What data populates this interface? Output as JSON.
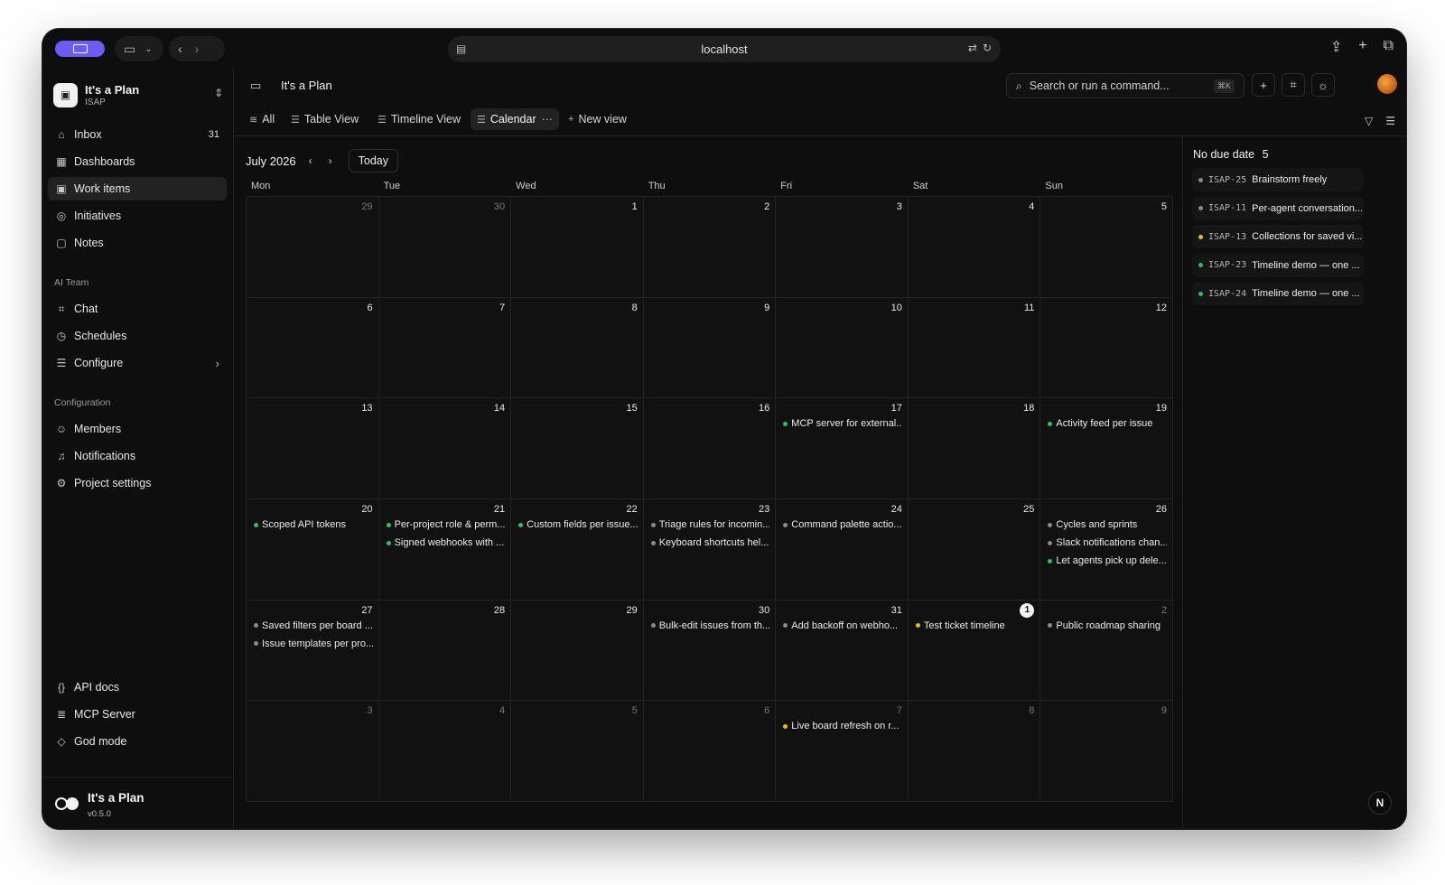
{
  "browser": {
    "url": "localhost"
  },
  "workspace": {
    "name": "It's a Plan",
    "key": "ISAP"
  },
  "sidebar": {
    "primary": [
      {
        "label": "Inbox",
        "icon": "inbox-icon",
        "count": "31"
      },
      {
        "label": "Dashboards",
        "icon": "dashboard-icon"
      },
      {
        "label": "Work items",
        "icon": "work-items-icon",
        "active": true
      },
      {
        "label": "Initiatives",
        "icon": "target-icon"
      },
      {
        "label": "Notes",
        "icon": "note-icon"
      }
    ],
    "ai_team_label": "AI Team",
    "ai_team": [
      {
        "label": "Chat",
        "icon": "chat-icon"
      },
      {
        "label": "Schedules",
        "icon": "clock-icon"
      },
      {
        "label": "Configure",
        "icon": "sliders-icon"
      }
    ],
    "configuration_label": "Configuration",
    "configuration": [
      {
        "label": "Members",
        "icon": "users-icon"
      },
      {
        "label": "Notifications",
        "icon": "bell-icon"
      },
      {
        "label": "Project settings",
        "icon": "gear-icon"
      }
    ],
    "bottom": [
      {
        "label": "API docs",
        "icon": "braces-icon"
      },
      {
        "label": "MCP Server",
        "icon": "server-icon"
      },
      {
        "label": "God mode",
        "icon": "shield-icon"
      }
    ],
    "brand": {
      "name": "It's a Plan",
      "version": "v0.5.0"
    }
  },
  "header": {
    "title": "It's a Plan",
    "search_placeholder": "Search or run a command...",
    "search_shortcut": "⌘K"
  },
  "tabs": [
    {
      "label": "All",
      "icon": "layers-icon"
    },
    {
      "label": "Table View",
      "icon": "list-icon"
    },
    {
      "label": "Timeline View",
      "icon": "list-icon"
    },
    {
      "label": "Calendar",
      "icon": "list-icon",
      "active": true
    },
    {
      "label": "New view",
      "icon": "plus-icon"
    }
  ],
  "calendar": {
    "month": "July 2026",
    "today_label": "Today",
    "weekdays": [
      "Mon",
      "Tue",
      "Wed",
      "Thu",
      "Fri",
      "Sat",
      "Sun"
    ],
    "weeks": [
      [
        {
          "day": "29",
          "other": true,
          "events": []
        },
        {
          "day": "30",
          "other": true,
          "events": []
        },
        {
          "day": "1",
          "events": []
        },
        {
          "day": "2",
          "events": []
        },
        {
          "day": "3",
          "events": []
        },
        {
          "day": "4",
          "events": []
        },
        {
          "day": "5",
          "events": []
        }
      ],
      [
        {
          "day": "6",
          "events": []
        },
        {
          "day": "7",
          "events": []
        },
        {
          "day": "8",
          "events": []
        },
        {
          "day": "9",
          "events": []
        },
        {
          "day": "10",
          "events": []
        },
        {
          "day": "11",
          "events": []
        },
        {
          "day": "12",
          "events": []
        }
      ],
      [
        {
          "day": "13",
          "events": []
        },
        {
          "day": "14",
          "events": []
        },
        {
          "day": "15",
          "events": []
        },
        {
          "day": "16",
          "events": []
        },
        {
          "day": "17",
          "events": [
            {
              "title": "MCP server for external...",
              "status": "green"
            }
          ]
        },
        {
          "day": "18",
          "events": []
        },
        {
          "day": "19",
          "events": [
            {
              "title": "Activity feed per issue",
              "status": "green"
            }
          ]
        }
      ],
      [
        {
          "day": "20",
          "events": [
            {
              "title": "Scoped API tokens",
              "status": "green"
            }
          ]
        },
        {
          "day": "21",
          "events": [
            {
              "title": "Per-project role & perm...",
              "status": "green"
            },
            {
              "title": "Signed webhooks with ...",
              "status": "green"
            }
          ]
        },
        {
          "day": "22",
          "events": [
            {
              "title": "Custom fields per issue...",
              "status": "green"
            }
          ]
        },
        {
          "day": "23",
          "events": [
            {
              "title": "Triage rules for incomin...",
              "status": "gray"
            },
            {
              "title": "Keyboard shortcuts hel...",
              "status": "gray"
            }
          ]
        },
        {
          "day": "24",
          "events": [
            {
              "title": "Command palette actio...",
              "status": "gray"
            }
          ]
        },
        {
          "day": "25",
          "events": []
        },
        {
          "day": "26",
          "events": [
            {
              "title": "Cycles and sprints",
              "status": "gray"
            },
            {
              "title": "Slack notifications chan...",
              "status": "gray"
            },
            {
              "title": "Let agents pick up dele...",
              "status": "green"
            }
          ]
        }
      ],
      [
        {
          "day": "27",
          "events": [
            {
              "title": "Saved filters per board ...",
              "status": "gray"
            },
            {
              "title": "Issue templates per pro...",
              "status": "gray"
            }
          ]
        },
        {
          "day": "28",
          "events": []
        },
        {
          "day": "29",
          "events": []
        },
        {
          "day": "30",
          "events": [
            {
              "title": "Bulk-edit issues from th...",
              "status": "gray"
            }
          ]
        },
        {
          "day": "31",
          "events": [
            {
              "title": "Add backoff on webho...",
              "status": "gray"
            }
          ]
        },
        {
          "day": "1",
          "other": true,
          "today": true,
          "events": [
            {
              "title": "Test ticket timeline",
              "status": "amber"
            }
          ]
        },
        {
          "day": "2",
          "other": true,
          "events": [
            {
              "title": "Public roadmap sharing",
              "status": "gray"
            }
          ]
        }
      ],
      [
        {
          "day": "3",
          "other": true,
          "events": []
        },
        {
          "day": "4",
          "other": true,
          "events": []
        },
        {
          "day": "5",
          "other": true,
          "events": []
        },
        {
          "day": "6",
          "other": true,
          "events": []
        },
        {
          "day": "7",
          "other": true,
          "events": [
            {
              "title": "Live board refresh on r...",
              "status": "amber"
            }
          ]
        },
        {
          "day": "8",
          "other": true,
          "events": []
        },
        {
          "day": "9",
          "other": true,
          "events": []
        }
      ]
    ]
  },
  "no_due_date": {
    "label": "No due date",
    "count": "5",
    "items": [
      {
        "key": "ISAP-25",
        "title": "Brainstorm freely",
        "status": "gray"
      },
      {
        "key": "ISAP-11",
        "title": "Per-agent conversation...",
        "status": "gray"
      },
      {
        "key": "ISAP-13",
        "title": "Collections for saved vi...",
        "status": "amber"
      },
      {
        "key": "ISAP-23",
        "title": "Timeline demo — one ...",
        "status": "green"
      },
      {
        "key": "ISAP-24",
        "title": "Timeline demo — one ...",
        "status": "green"
      }
    ]
  },
  "corner_badge": "N",
  "colors": {
    "green": "#22c55e",
    "gray": "#8a8a8a",
    "amber": "#f5b324",
    "accent": "#6b5cf6"
  }
}
